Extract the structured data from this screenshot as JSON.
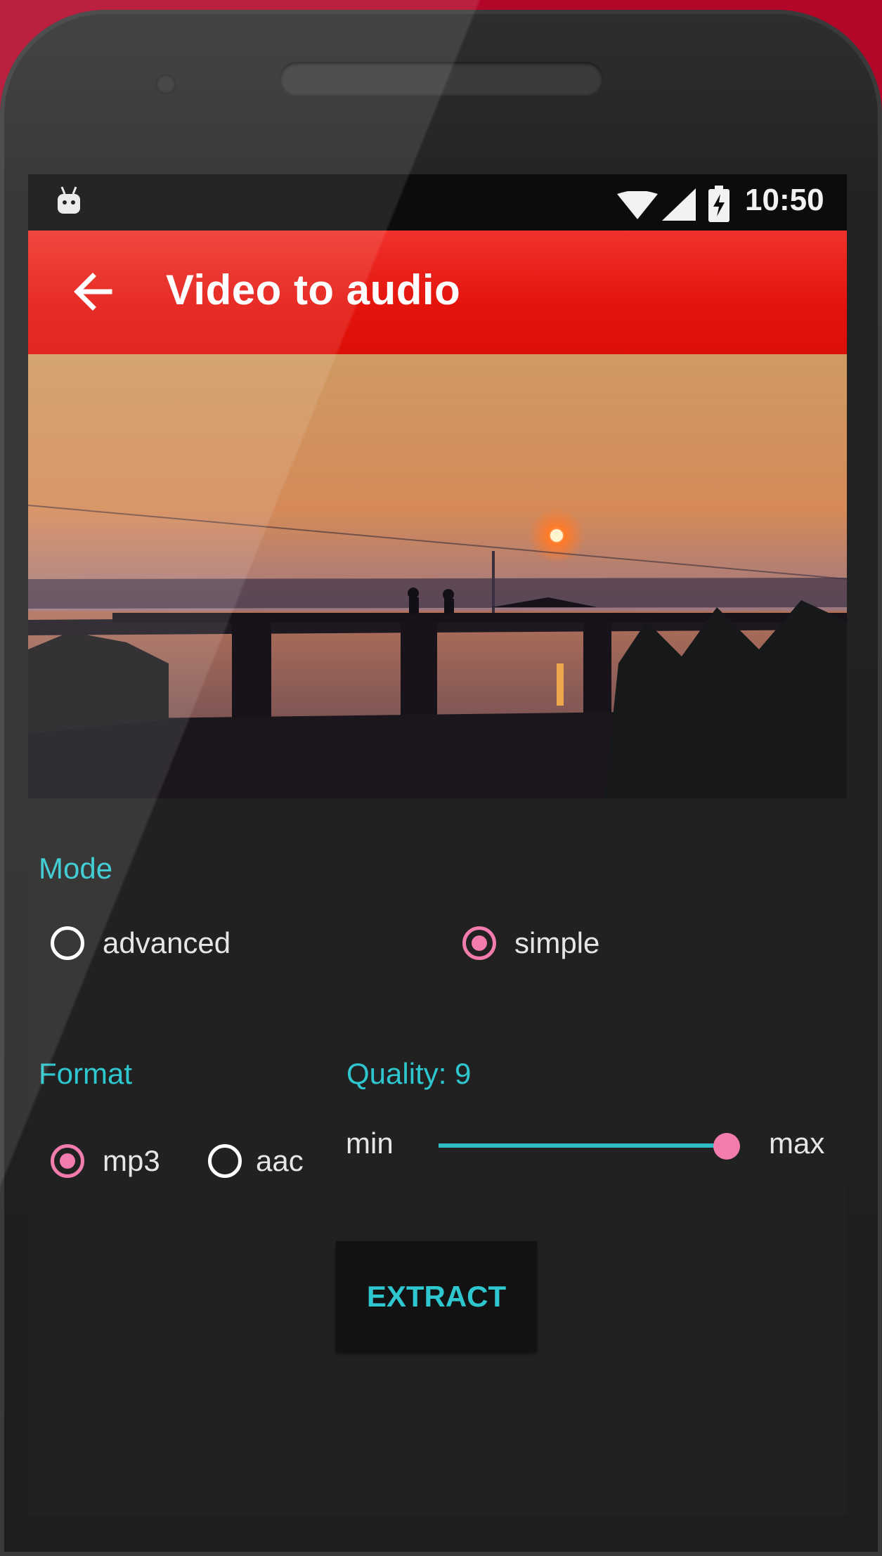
{
  "status_bar": {
    "time": "10:50"
  },
  "toolbar": {
    "title": "Video to audio"
  },
  "mode": {
    "label": "Mode",
    "options": [
      {
        "label": "advanced",
        "selected": false
      },
      {
        "label": "simple",
        "selected": true
      }
    ]
  },
  "format": {
    "label": "Format",
    "options": [
      {
        "label": "mp3",
        "selected": true
      },
      {
        "label": "aac",
        "selected": false
      }
    ]
  },
  "quality": {
    "label": "Quality: 9",
    "value": 9,
    "min_label": "min",
    "max_label": "max",
    "level_fraction": 1.0
  },
  "extract_label": "EXTRACT",
  "colors": {
    "accent_teal": "#2ec7cf",
    "accent_pink": "#f27cad",
    "toolbar_red": "#e4140c",
    "background": "#212121"
  }
}
